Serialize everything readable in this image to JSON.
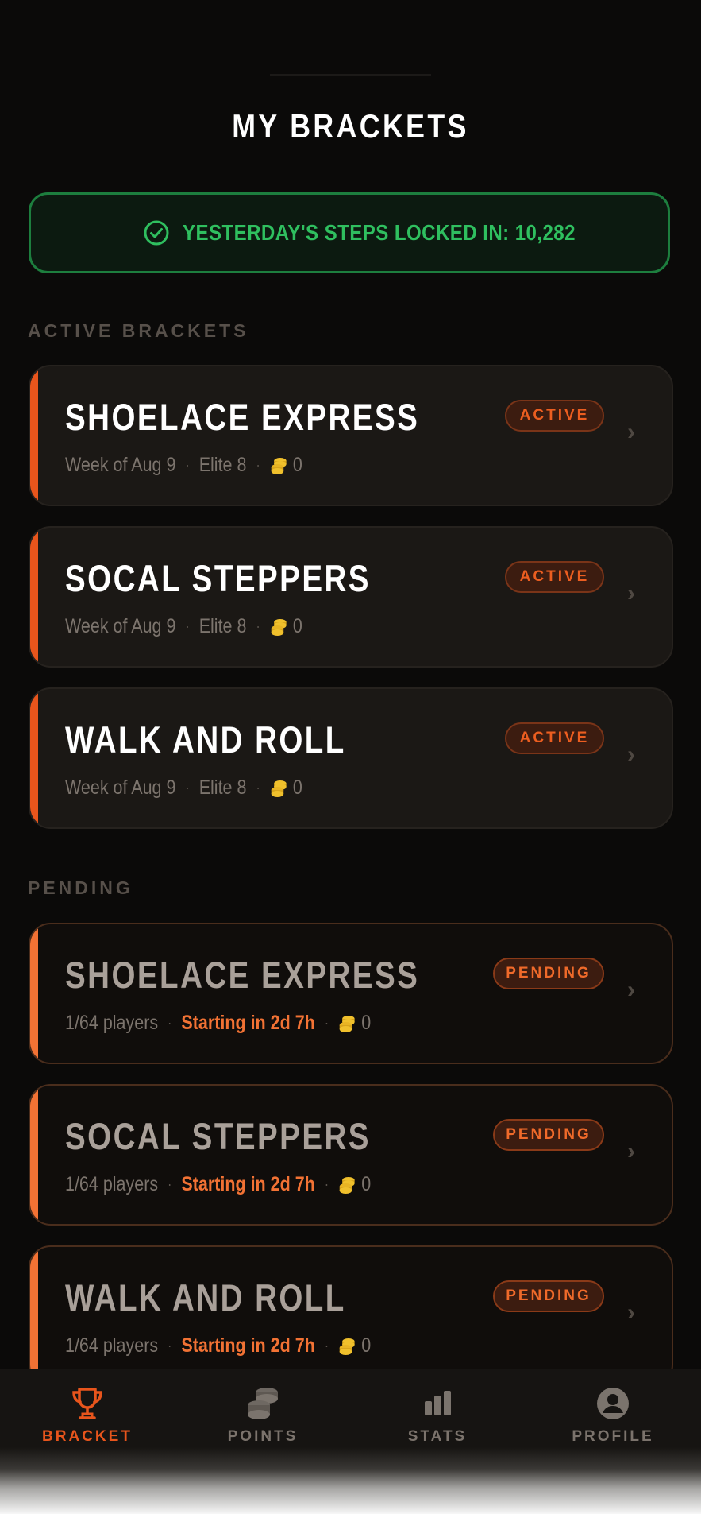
{
  "page": {
    "title": "MY BRACKETS"
  },
  "steps_banner": {
    "text": "YESTERDAY'S STEPS LOCKED IN: 10,282",
    "icon": "check-circle-icon",
    "color": "#2fbf5f"
  },
  "sections": {
    "active_heading": "ACTIVE BRACKETS",
    "pending_heading": "PENDING"
  },
  "active_brackets": [
    {
      "name": "SHOELACE EXPRESS",
      "status": "ACTIVE",
      "week": "Week of Aug 9",
      "round": "Elite 8",
      "coins": "0"
    },
    {
      "name": "SOCAL STEPPERS",
      "status": "ACTIVE",
      "week": "Week of Aug 9",
      "round": "Elite 8",
      "coins": "0"
    },
    {
      "name": "WALK AND ROLL",
      "status": "ACTIVE",
      "week": "Week of Aug 9",
      "round": "Elite 8",
      "coins": "0"
    }
  ],
  "pending_brackets": [
    {
      "name": "SHOELACE EXPRESS",
      "status": "PENDING",
      "players": "1/64 players",
      "starting": "Starting in 2d 7h",
      "coins": "0"
    },
    {
      "name": "SOCAL STEPPERS",
      "status": "PENDING",
      "players": "1/64 players",
      "starting": "Starting in 2d 7h",
      "coins": "0"
    },
    {
      "name": "WALK AND ROLL",
      "status": "PENDING",
      "players": "1/64 players",
      "starting": "Starting in 2d 7h",
      "coins": "0"
    }
  ],
  "separator": "·",
  "chevron": "›",
  "bottom_nav": [
    {
      "label": "BRACKET",
      "icon": "trophy-icon",
      "selected": true
    },
    {
      "label": "POINTS",
      "icon": "coins-icon",
      "selected": false
    },
    {
      "label": "STATS",
      "icon": "bar-chart-icon",
      "selected": false
    },
    {
      "label": "PROFILE",
      "icon": "user-circle-icon",
      "selected": false
    }
  ],
  "colors": {
    "accent": "#e8551c",
    "pending_accent": "#f27234",
    "success": "#2fbf5f",
    "background": "#0b0a09"
  }
}
